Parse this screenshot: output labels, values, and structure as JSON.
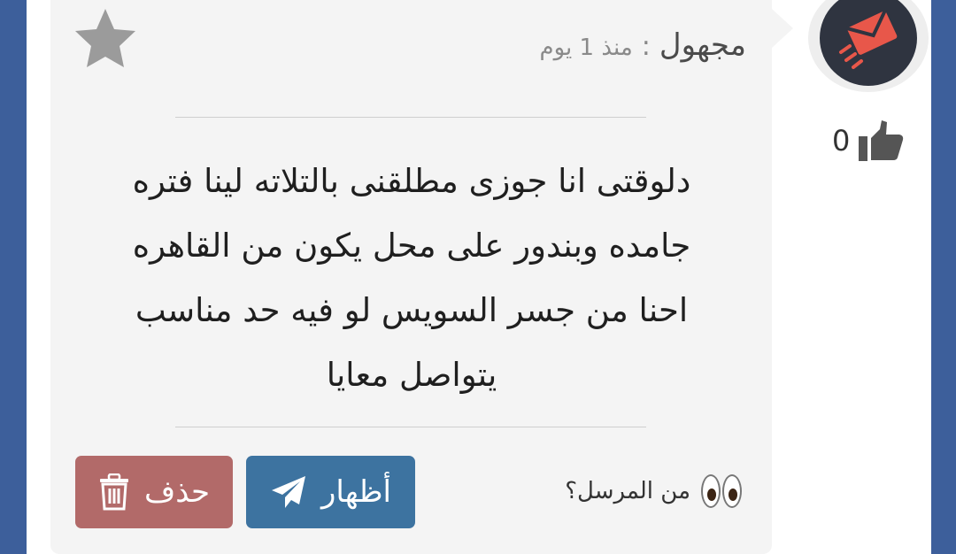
{
  "message": {
    "sender": "مجهول",
    "separator": ":",
    "time": "منذ 1 يوم",
    "text_lines": [
      "دلوقتى انا جوزى مطلقنى بالتلاته لينا فتره",
      "جامده وبندور على محل يكون من القاهره",
      "احنا من جسر السويس لو فيه حد مناسب",
      "يتواصل معايا"
    ],
    "who_sent_label": "من المرسل؟",
    "reveal_label": "أظهار",
    "delete_label": "حذف",
    "like_count": "0",
    "favorited": false
  },
  "icons": {
    "star": "star-icon",
    "eyes": "eyes-icon",
    "reveal": "paper-plane-icon",
    "delete": "trash-icon",
    "like": "thumbs-up-icon",
    "avatar": "envelope-logo-icon"
  },
  "colors": {
    "page_background": "#3d5f9b",
    "card_background": "#f4f4f4",
    "reveal_button": "#3d73a0",
    "delete_button": "#b26a69",
    "avatar_background": "#2f3440",
    "avatar_accent": "#e8574a"
  }
}
